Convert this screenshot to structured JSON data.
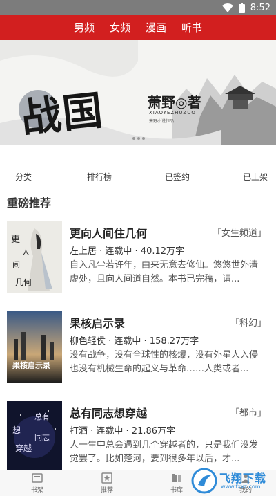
{
  "status_bar": {
    "time": "8:52"
  },
  "top_tabs": [
    "男频",
    "女频",
    "漫画",
    "听书"
  ],
  "banner": {
    "title": "战国",
    "author": "萧野◎著",
    "pinyin": "XIAOYEZHUZUO",
    "small_text": "萧野小说作品"
  },
  "quick_links": [
    "分类",
    "排行榜",
    "已签约",
    "已上架"
  ],
  "section_title": "重磅推荐",
  "books": [
    {
      "title": "更向人间住几何",
      "tag": "「女生频道」",
      "meta": "左上居 · 连载中 · 40.12万字",
      "desc": "自入凡尘若许年，由来无意去修仙。悠悠世外清虚处，且向人间道自然。本书已完稿，请...",
      "cover_text": "更向人间住几何"
    },
    {
      "title": "果核启示录",
      "tag": "「科幻」",
      "meta": "柳色轻侯 · 连载中 · 158.27万字",
      "desc": "没有战争，没有全球性的核爆，没有外星人入侵也没有机械生命的起义与革命……人类或者...",
      "cover_text": "果核启示录"
    },
    {
      "title": "总有同志想穿越",
      "tag": "「都市」",
      "meta": "打酒 · 连载中 · 21.86万字",
      "desc": "人一生中总会遇到几个穿越者的，只是我们没发觉罢了。比如楚河，要到很多年以后，才...",
      "cover_text": "总有同志想穿越"
    }
  ],
  "bottom_nav": [
    "书架",
    "推荐",
    "书库",
    "我的"
  ],
  "watermark": {
    "text": "飞翔下载",
    "sub": "www.fxxz.com"
  }
}
